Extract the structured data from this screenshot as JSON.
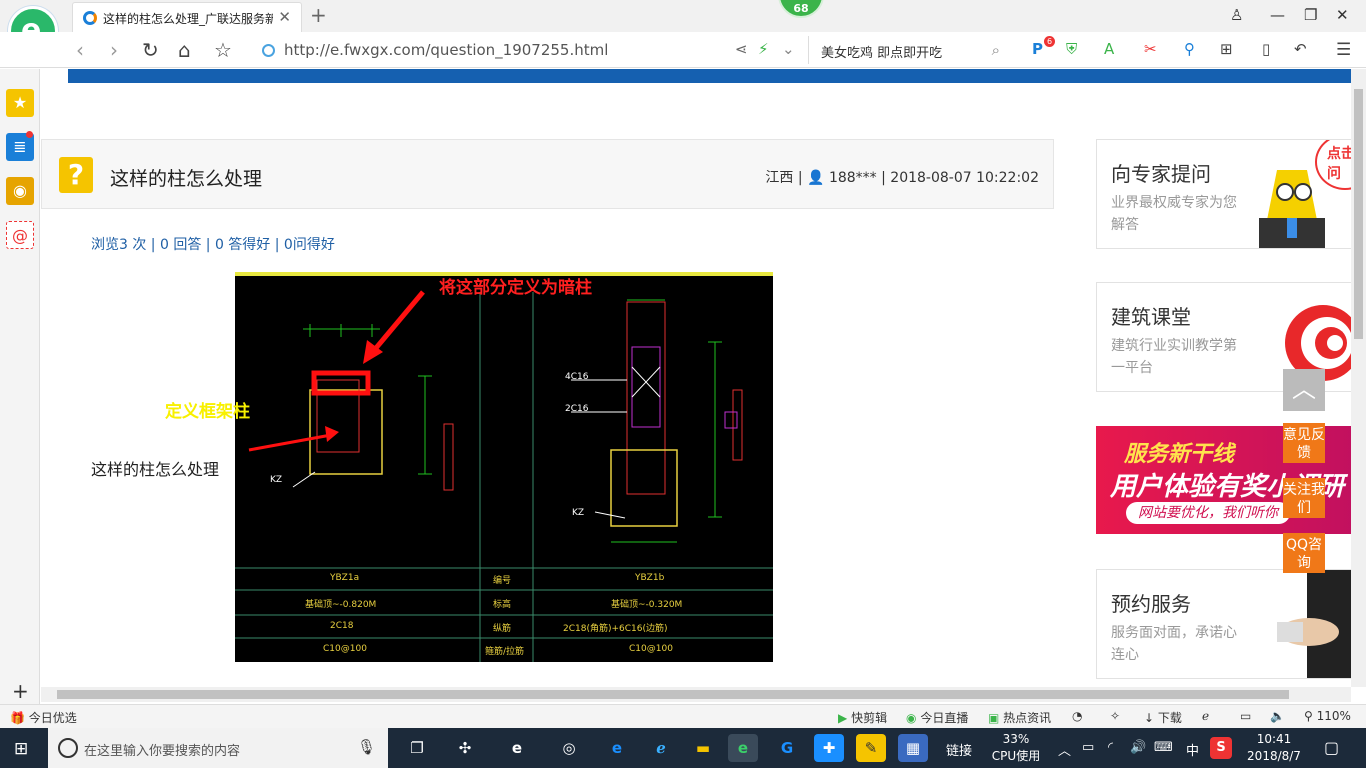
{
  "browser": {
    "tab_title": "这样的柱怎么处理_广联达服务新",
    "badge": "68",
    "url": "http://e.fwxgx.com/question_1907255.html",
    "search_text": "美女吃鸡 即点即开吃",
    "ext_badge": "6"
  },
  "question": {
    "title": "这样的柱怎么处理",
    "region": "江西",
    "user": "188***",
    "datetime": "2018-08-07 10:22:02",
    "stats": "浏览3 次 | 0 回答 | 0 答得好 | 0问得好",
    "body": "这样的柱怎么处理"
  },
  "image": {
    "annotation_red": "将这部分定义为暗柱",
    "annotation_yellow": "定义框架柱",
    "kz_left": "KZ",
    "kz_right": "KZ",
    "rebar_4c16": "4C16",
    "rebar_2c16": "2C16",
    "table": {
      "col1": [
        "YBZ1a",
        "基础顶~-0.820M",
        "2C18",
        "C10@100"
      ],
      "col2": [
        "编号",
        "标高",
        "纵筋",
        "箍筋/拉筋"
      ],
      "col3": [
        "YBZ1b",
        "基础顶~-0.320M",
        "2C18(角筋)+6C16(边筋)",
        "C10@100"
      ]
    }
  },
  "sidebar_cards": [
    {
      "title": "向专家提问",
      "desc": "业界最权威专家为您解答"
    },
    {
      "title": "建筑课堂",
      "desc": "建筑行业实训教学第一平台"
    },
    {
      "title": "预约服务",
      "desc": "服务面对面，承诺心连心"
    }
  ],
  "mascot_bubble": "点击提问",
  "promo": {
    "line1": "服务新干线",
    "line2": "用户体验有奖小调研",
    "line3": "网站要优化，我们听你"
  },
  "float_buttons": [
    "意见反馈",
    "关注我们",
    "QQ咨询"
  ],
  "statusbar": {
    "left": "今日优选",
    "items": [
      "快剪辑",
      "今日直播",
      "热点资讯",
      "下载"
    ],
    "zoom": "110%"
  },
  "taskbar": {
    "search_placeholder": "在这里输入你要搜索的内容",
    "links": "链接",
    "cpu_percent": "33%",
    "cpu_label": "CPU使用",
    "ime": "中",
    "time": "10:41",
    "date": "2018/8/7"
  },
  "colors": {
    "accent_blue": "#1560b0",
    "link_blue": "#1f5fa5",
    "float_orange": "#f07818",
    "question_icon": "#f5c400"
  }
}
